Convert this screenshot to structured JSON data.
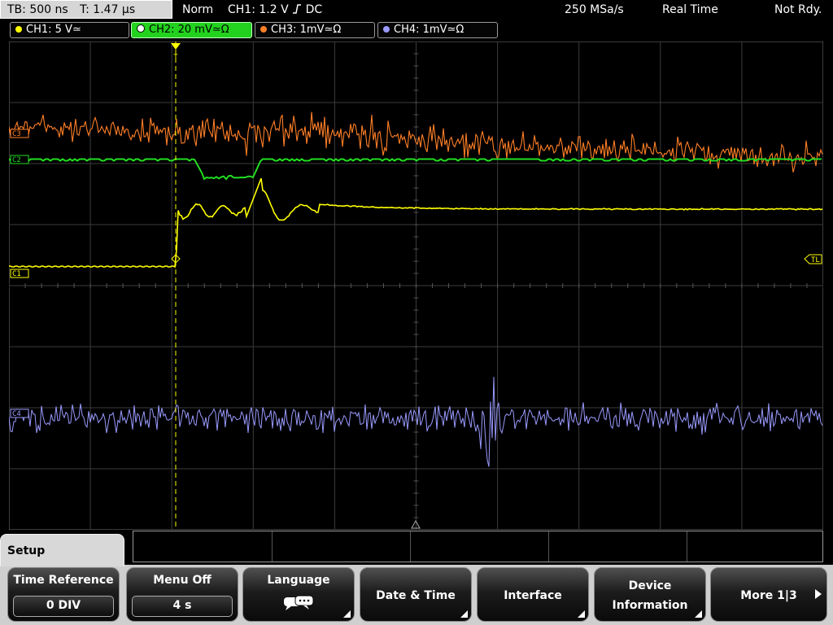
{
  "status": {
    "timebase": "TB: 500 ns",
    "trigger_time": "T: 1.47 µs",
    "mode": "Norm",
    "trigger_info": "CH1: 1.2 V",
    "trigger_info_suffix": "DC",
    "sample_rate": "250 MSa/s",
    "acq_mode": "Real Time",
    "state": "Not Rdy."
  },
  "channels": [
    {
      "label": "CH1: 5 V",
      "coupling": "≃",
      "color": "#ffff00",
      "active": false
    },
    {
      "label": "CH2: 20 mV",
      "coupling": "≃Ω",
      "color": "#22dd22",
      "active": true
    },
    {
      "label": "CH3: 1mV",
      "coupling": "≃Ω",
      "color": "#ff7f27",
      "active": false
    },
    {
      "label": "CH4: 1mV",
      "coupling": "≃Ω",
      "color": "#9a9aff",
      "active": false
    }
  ],
  "markers": {
    "ch1": "C1",
    "ch2": "C2",
    "ch3": "C3",
    "ch4": "C4",
    "trigger_level": "TL",
    "trigger_pos": "T"
  },
  "menu": {
    "title": "Setup",
    "softkeys": [
      {
        "label": "Time Reference",
        "value": "0 DIV"
      },
      {
        "label": "Menu Off",
        "value": "4 s"
      },
      {
        "label": "Language",
        "icon": "speech-bubble-icon"
      },
      {
        "label": "Date & Time"
      },
      {
        "label": "Interface"
      },
      {
        "label": "Device",
        "label2": "Information"
      },
      {
        "label": "More 1|3"
      }
    ]
  },
  "colors": {
    "ch1": "#ffff00",
    "ch2": "#22dd22",
    "ch3": "#ff7f27",
    "ch4": "#9a9aff",
    "grid": "#3c3c3c"
  }
}
